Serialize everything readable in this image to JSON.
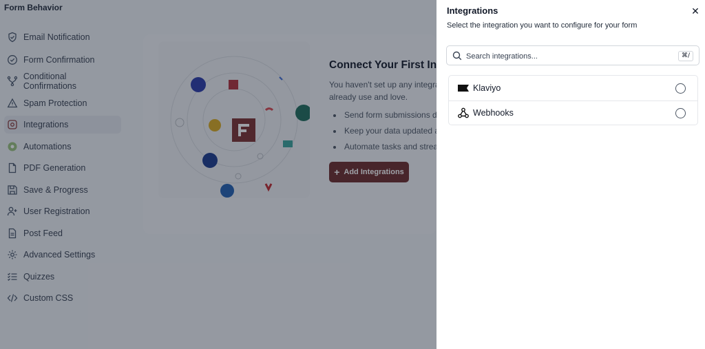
{
  "app": {
    "title": "Form Behavior"
  },
  "sidebar": {
    "items": [
      {
        "label": "Email Notification",
        "icon": "shield-check-icon"
      },
      {
        "label": "Form Confirmation",
        "icon": "check-circle-icon"
      },
      {
        "label": "Conditional Confirmations",
        "icon": "branch-icon"
      },
      {
        "label": "Spam Protection",
        "icon": "warning-triangle-icon"
      },
      {
        "label": "Integrations",
        "icon": "integrations-icon",
        "active": true
      },
      {
        "label": "Automations",
        "icon": "automations-icon"
      },
      {
        "label": "PDF Generation",
        "icon": "document-icon"
      },
      {
        "label": "Save & Progress",
        "icon": "save-icon"
      },
      {
        "label": "User Registration",
        "icon": "user-add-icon"
      },
      {
        "label": "Post Feed",
        "icon": "post-icon"
      },
      {
        "label": "Advanced Settings",
        "icon": "gear-icon"
      },
      {
        "label": "Quizzes",
        "icon": "list-check-icon"
      },
      {
        "label": "Custom CSS",
        "icon": "code-icon"
      }
    ]
  },
  "main": {
    "heading": "Connect Your First Integ",
    "description": "You haven't set up any integra already use and love.",
    "bullets": [
      "Send form submissions di",
      "Keep your data updated a",
      "Automate tasks and stream"
    ],
    "add_button": "Add Integrations"
  },
  "drawer": {
    "title": "Integrations",
    "subtitle": "Select the integration you want to configure for your form",
    "close_icon": "close-icon",
    "search": {
      "placeholder": "Search integrations...",
      "shortcut": "⌘/"
    },
    "integrations": [
      {
        "name": "Klaviyo",
        "icon": "klaviyo-flag-icon",
        "selected": false
      },
      {
        "name": "Webhooks",
        "icon": "webhook-icon",
        "selected": false
      }
    ]
  },
  "colors": {
    "accent": "#6b2a2a",
    "overlay": "rgba(25,32,45,0.42)"
  }
}
